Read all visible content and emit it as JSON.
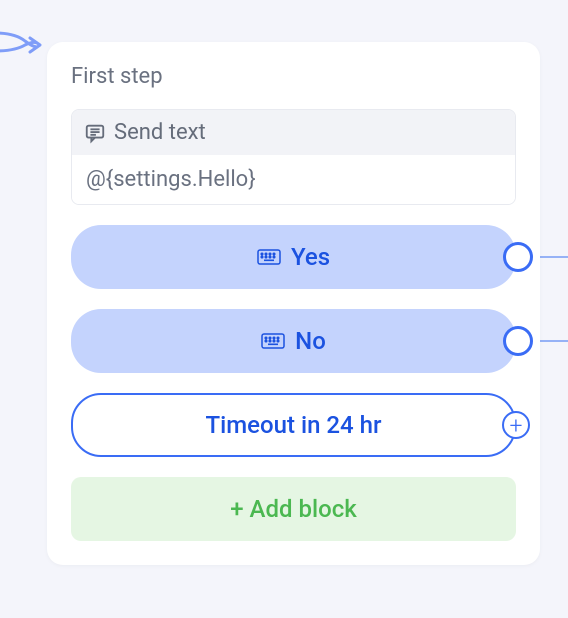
{
  "card": {
    "title": "First step"
  },
  "sendText": {
    "header": "Send text",
    "value": "@{settings.Hello}"
  },
  "options": [
    {
      "label": "Yes"
    },
    {
      "label": "No"
    }
  ],
  "timeout": {
    "label": "Timeout in 24 hr"
  },
  "addBlock": {
    "label": "+ Add block"
  }
}
